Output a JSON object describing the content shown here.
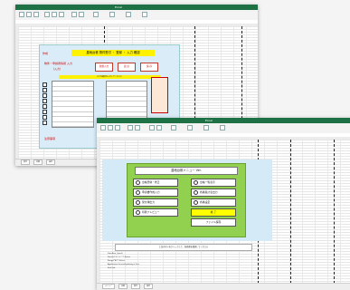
{
  "window1": {
    "title": "Excel",
    "form_title": "農地台帳 物件受付 ・ 登録 ・ 入力 確認",
    "red_label1": "作成",
    "red_label2": "物件・申請者情報 入力",
    "red_label3": "（入力）",
    "button_a": "新規入力",
    "button_b": "表 示",
    "button_c": "保 存",
    "yellow_bar": "以下の項目を入力してください",
    "bottom_label": "注意事項",
    "sheet_tabs": [
      "受付",
      "台帳",
      "設定"
    ]
  },
  "window2": {
    "title": "Excel",
    "menu_title": "農地台帳メニュー Ver.",
    "menu_buttons": [
      {
        "label": "台帳登録・修正",
        "style": "radio"
      },
      {
        "label": "台帳一覧表示",
        "style": "radio"
      },
      {
        "label": "申請書作成入力",
        "style": "radio"
      },
      {
        "label": "各種集計表出力",
        "style": "radio"
      },
      {
        "label": "受付簿出力",
        "style": "radio"
      },
      {
        "label": "各種設定",
        "style": "radio"
      },
      {
        "label": "印刷プレビュー",
        "style": "radio"
      },
      {
        "label": "終 了",
        "style": "yellow"
      },
      {
        "label": "ファイル保存",
        "style": "white"
      }
    ],
    "note": "上記ボタンをクリックして、各処理を選択してください",
    "code_lines": [
      "Sub Auto_Open()",
      "  Sheets(\"メニュー\").Select",
      "  Range(\"A1\").Select",
      "  Application.ScreenUpdating = True",
      "End Sub"
    ],
    "sheet_tabs": [
      "メニュー",
      "台帳",
      "受付",
      "設定"
    ]
  }
}
